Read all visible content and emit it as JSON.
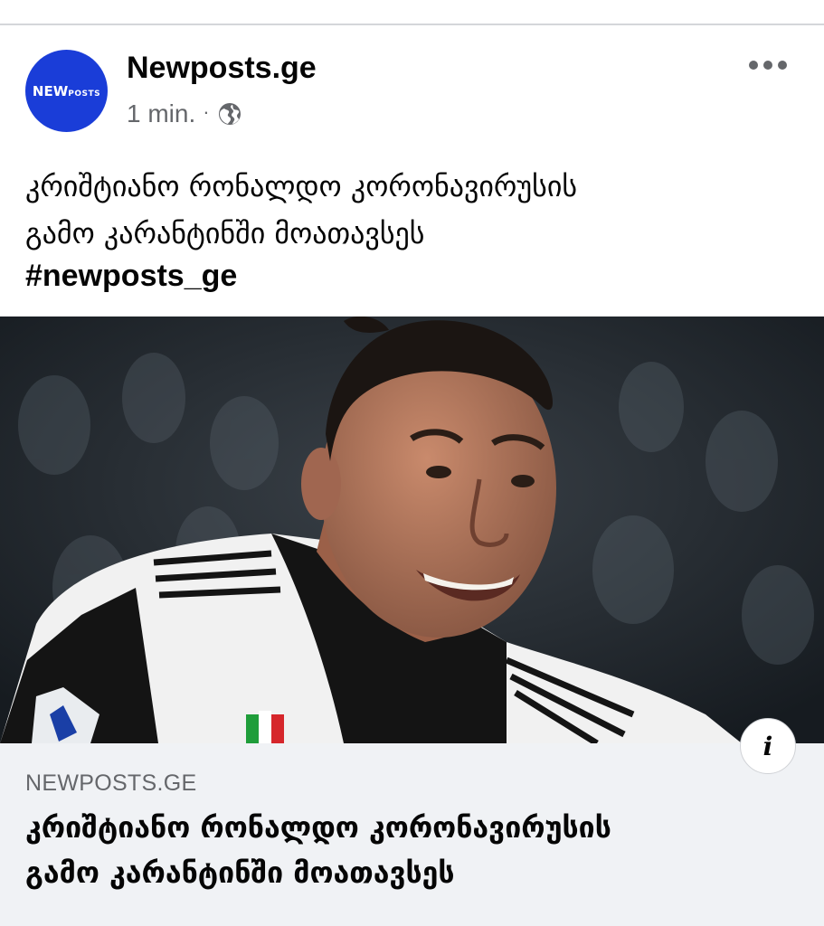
{
  "post": {
    "page_name": "Newposts.ge",
    "avatar_logo_main": "NEW",
    "avatar_logo_sub": "POSTS",
    "time": "1 min.",
    "separator": "·",
    "privacy_icon": "globe-icon",
    "more_icon": "more-options-icon",
    "text_lines": [
      "კრიშტიანო რონალდო კორონავირუსის",
      "გამო კარანტინში მოათავსეს"
    ],
    "hashtag": "#newposts_ge"
  },
  "link_preview": {
    "domain": "NEWPOSTS.GE",
    "title_lines": [
      "კრიშტიანო რონალდო კორონავირუსის",
      "გამო კარანტინში მოათავსეს"
    ],
    "info_icon": "info-icon",
    "info_label": "i"
  },
  "colors": {
    "avatar_bg": "#1a3dd8",
    "card_bg": "#f0f2f5",
    "secondary_text": "#65676b"
  }
}
